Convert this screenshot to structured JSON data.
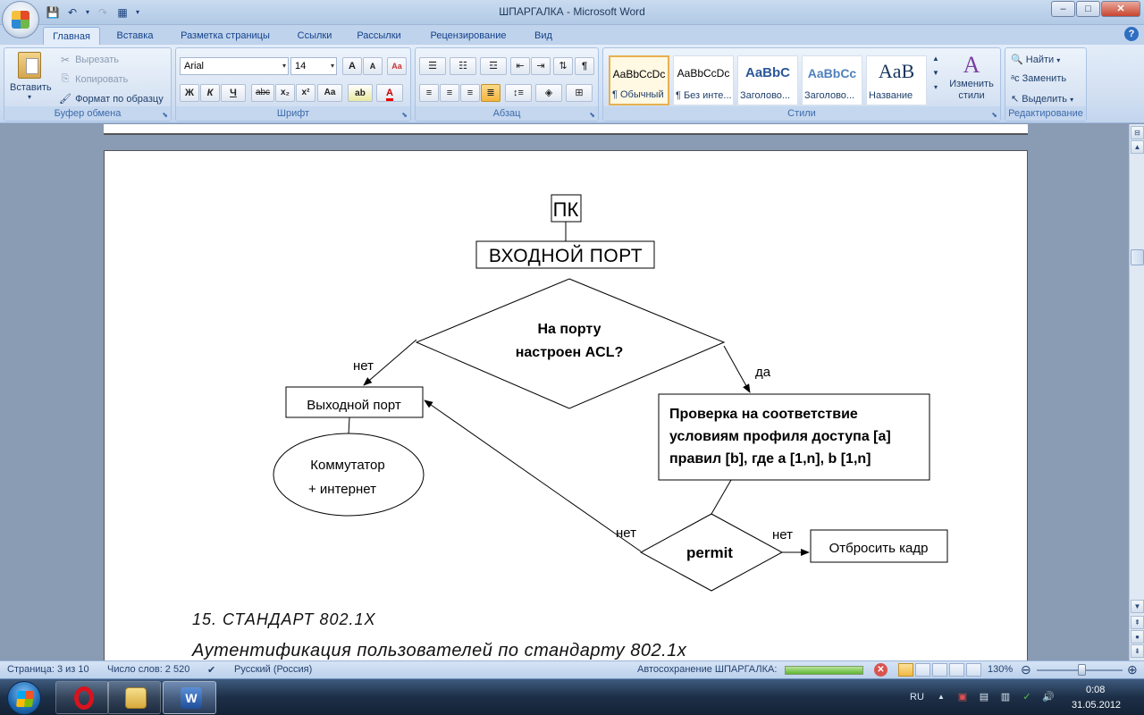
{
  "window": {
    "title": "ШПАРГАЛКА - Microsoft Word",
    "controls": [
      "–",
      "□",
      "✕"
    ]
  },
  "quick_access": [
    "save-icon",
    "undo-icon",
    "redo-icon",
    "customize-icon"
  ],
  "tabs": [
    "Главная",
    "Вставка",
    "Разметка страницы",
    "Ссылки",
    "Рассылки",
    "Рецензирование",
    "Вид"
  ],
  "active_tab": "Главная",
  "ribbon": {
    "clipboard": {
      "label": "Буфер обмена",
      "paste": "Вставить",
      "cut": "Вырезать",
      "copy": "Копировать",
      "format_painter": "Формат по образцу"
    },
    "font": {
      "label": "Шрифт",
      "family": "Arial",
      "size": "14",
      "grow": "A",
      "shrink": "A",
      "bold": "Ж",
      "italic": "К",
      "underline": "Ч",
      "strike": "abc",
      "subscript": "x₂",
      "superscript": "x²",
      "change_case": "Aa"
    },
    "paragraph": {
      "label": "Абзац"
    },
    "styles": {
      "label": "Стили",
      "items": [
        {
          "sample": "AaBbCcDc",
          "name": "¶ Обычный"
        },
        {
          "sample": "AaBbCcDc",
          "name": "¶ Без инте..."
        },
        {
          "sample": "AaBbC",
          "name": "Заголово..."
        },
        {
          "sample": "AaBbCc",
          "name": "Заголово..."
        },
        {
          "sample": "AaB",
          "name": "Название"
        }
      ],
      "change_styles": "Изменить стили"
    },
    "editing": {
      "label": "Редактирование",
      "find": "Найти",
      "replace": "Заменить",
      "select": "Выделить"
    }
  },
  "diagram": {
    "pc": "ПК",
    "input_port": "ВХОДНОЙ ПОРТ",
    "decision_acl_line1": "На порту",
    "decision_acl_line2": "настроен ACL?",
    "label_no_left": "нет",
    "label_yes": "да",
    "output_port": "Выходной порт",
    "switch_line1": "Коммутатор",
    "switch_line2": "+ интернет",
    "check_line1": "Проверка на соответствие",
    "check_line2": "условиям профиля доступа [a]",
    "check_line3": "правил [b], где a [1,n], b [1,n]",
    "permit": "permit",
    "label_no_permit_left": "нет",
    "label_no_permit_right": "нет",
    "drop_frame": "Отбросить кадр"
  },
  "document": {
    "heading_15": "15. СТАНДАРТ  802.1X",
    "heading_auth": "Аутентификация  пользователей  по стандарту  802.1x"
  },
  "status": {
    "page": "Страница: 3 из 10",
    "words": "Число слов: 2 520",
    "language": "Русский (Россия)",
    "autosave": "Автосохранение ШПАРГАЛКА:",
    "zoom": "130%",
    "autosave_progress": 1.0
  },
  "taskbar": {
    "apps": [
      "opera-icon",
      "explorer-icon",
      "word-icon"
    ],
    "language": "RU",
    "time": "0:08",
    "date": "31.05.2012"
  }
}
